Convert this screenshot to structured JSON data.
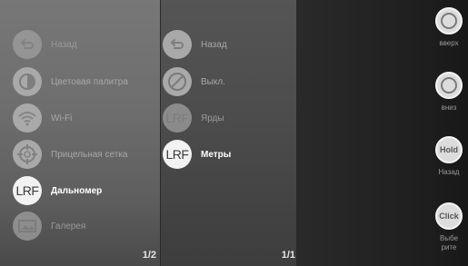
{
  "left_menu": {
    "items": [
      {
        "label": "Назад",
        "icon": "back-arrow-icon"
      },
      {
        "label": "Цветовая палитра",
        "icon": "color-palette-icon"
      },
      {
        "label": "Wi-Fi",
        "icon": "wifi-icon"
      },
      {
        "label": "Прицельная сетка",
        "icon": "crosshair-icon"
      },
      {
        "label": "Дальномер",
        "icon": "rangefinder-icon",
        "icon_text": "LRF",
        "selected": true
      },
      {
        "label": "Галерея",
        "icon": "gallery-icon"
      }
    ],
    "page": "1/2"
  },
  "sub_menu": {
    "items": [
      {
        "label": "Назад",
        "icon": "back-arrow-icon"
      },
      {
        "label": "Выкл.",
        "icon": "disabled-icon"
      },
      {
        "label": "Ярды",
        "icon": "rangefinder-icon",
        "icon_text": "LRF"
      },
      {
        "label": "Метры",
        "icon": "rangefinder-icon",
        "icon_text": "LRF",
        "selected": true
      }
    ],
    "page": "1/1"
  },
  "controls": [
    {
      "label": "вверх",
      "icon": "button-up-icon"
    },
    {
      "label": "вниз",
      "icon": "button-down-icon"
    },
    {
      "label": "Назад",
      "icon": "hold-button-icon",
      "icon_text": "Hold"
    },
    {
      "label": "Выбе\nрите",
      "icon": "click-button-icon",
      "icon_text": "Click"
    }
  ]
}
